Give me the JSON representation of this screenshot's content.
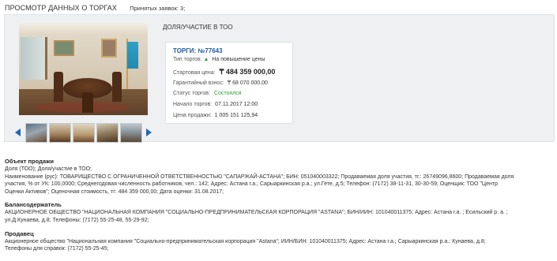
{
  "header": {
    "title": "ПРОСМОТР ДАННЫХ О ТОРГАХ",
    "applications_label": "Принятых заявок: 3;"
  },
  "lot": {
    "heading": "ДОЛЯ/УЧАСТИЕ В ТОО",
    "number": "ТОРГИ: №77643",
    "fields": {
      "type_label": "Тип торгов:",
      "type_value": "На повышение цены",
      "start_price_label": "Стартовая цена:",
      "start_price_value": "₸ 484 359 000,00",
      "guarantee_label": "Гарантийный взнос:",
      "guarantee_value": "₸ 68 070 000,00",
      "status_label": "Статус торгов:",
      "status_value": "Состоялся",
      "start_date_label": "Начало торгов:",
      "start_date_value": "07.11.2017 12:00",
      "sale_price_label": "Цена продажи:",
      "sale_price_value": "1 005 151 125,94"
    },
    "gallery": {
      "main_photo": "conference-room-photo",
      "thumbnails": [
        "thumb-1",
        "thumb-2",
        "thumb-3",
        "thumb-4",
        "thumb-5"
      ]
    }
  },
  "sections": [
    {
      "title": "Объект продажи",
      "lines": [
        "Доля (ТОО); Доля/участие в ТОО;",
        "Наименование (рус): ТОВАРИЩЕСТВО С ОГРАНИЧЕННОЙ ОТВЕТСТВЕННОСТЬЮ \"САПАРЖАЙ-АСТАНА\"; БИН: 051040003322; Продаваемая доля участия, тг.: 26749096,8600; Продаваемая доля",
        "участия, % от УК: 100,0000; Среднегодовая численность работников, чел.: 142; Адрес: Астана г.а.; Сарыаркинская р.а.; ул.Гете, д.5; Телефон: (7172) 38-11-31, 30-30-59; Оценщик: ТОО \"Центр",
        "Оценки Активов\"; Оценочная стоимость, тг: 484 359 000,00; Дата оценки: 31.08.2017;"
      ]
    },
    {
      "title": "Балансодержатель",
      "lines": [
        "АКЦИОНЕРНОЕ ОБЩЕСТВО \"НАЦИОНАЛЬНАЯ КОМПАНИЯ \"СОЦИАЛЬНО-ПРЕДПРИНИМАТЕЛЬСКАЯ КОРПОРАЦИЯ \"ASTANA\"; БИН/ИИН: 101040011375; Адрес: Астана г.а. ; Есильский р. а. ;",
        "ул.Д.Кунаева, д.8; Телефоны: (7172) 55-25-48, 55-29-92;"
      ]
    },
    {
      "title": "Продавец",
      "lines": [
        "Акционерное общество \"Национальная компания \"Социально-предпринимательская корпорация \"Astana\"; ИИН/БИН: 101040011375; Адрес: Астана г.а.; Сарыаркинская р.а.; Кунаева, д.8;",
        "Телефоны для справок: (7172) 55-25-45;"
      ]
    }
  ]
}
